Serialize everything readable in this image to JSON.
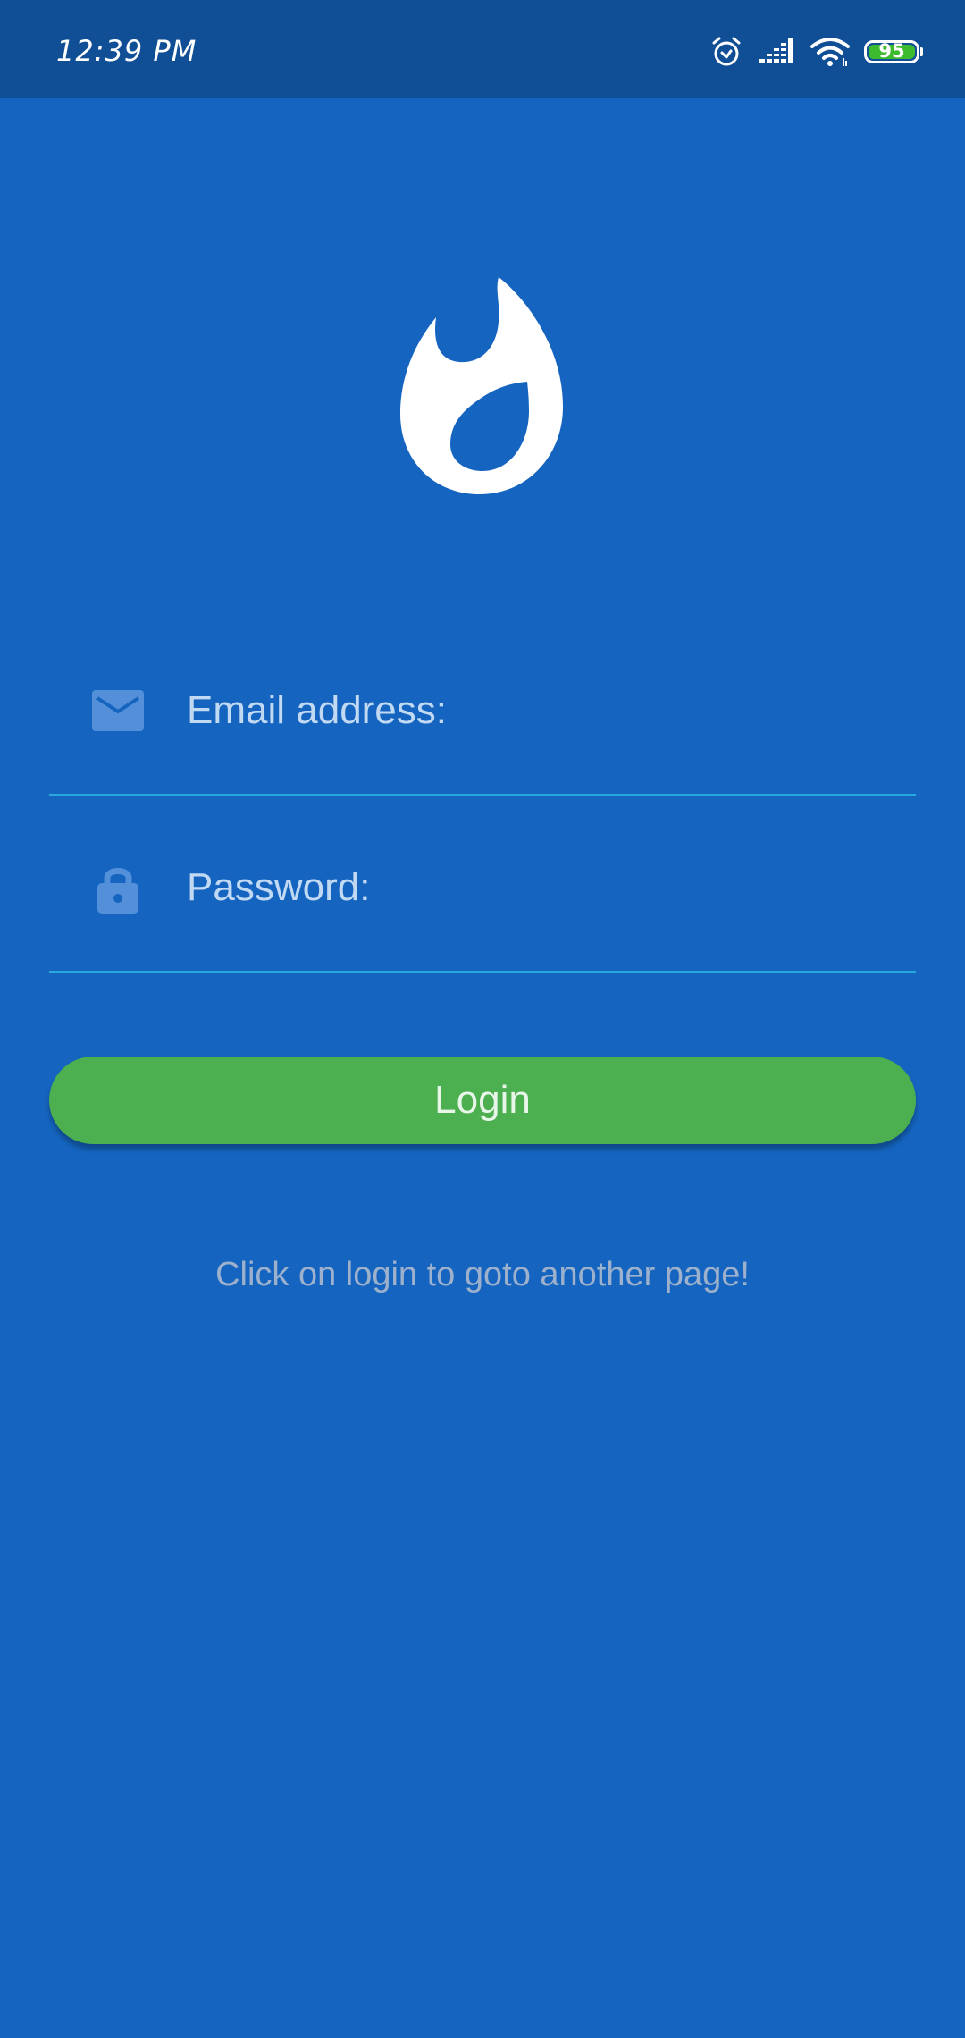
{
  "status_bar": {
    "time": "12:39 PM",
    "battery_level": "95",
    "icons": [
      "alarm-icon",
      "signal-icon",
      "wifi-icon",
      "battery-icon"
    ]
  },
  "logo": {
    "icon": "flame-icon",
    "color": "#FFFFFF"
  },
  "form": {
    "email": {
      "placeholder": "Email address:",
      "value": "",
      "icon": "mail-icon"
    },
    "password": {
      "placeholder": "Password:",
      "value": "",
      "icon": "lock-icon"
    },
    "login_label": "Login"
  },
  "hint_text": "Click on login to goto another page!",
  "colors": {
    "background": "#1565C0",
    "status_bar": "#104F95",
    "button": "#4CAF50",
    "field_underline": "#29A8E0",
    "battery": "#3DBB2F"
  }
}
